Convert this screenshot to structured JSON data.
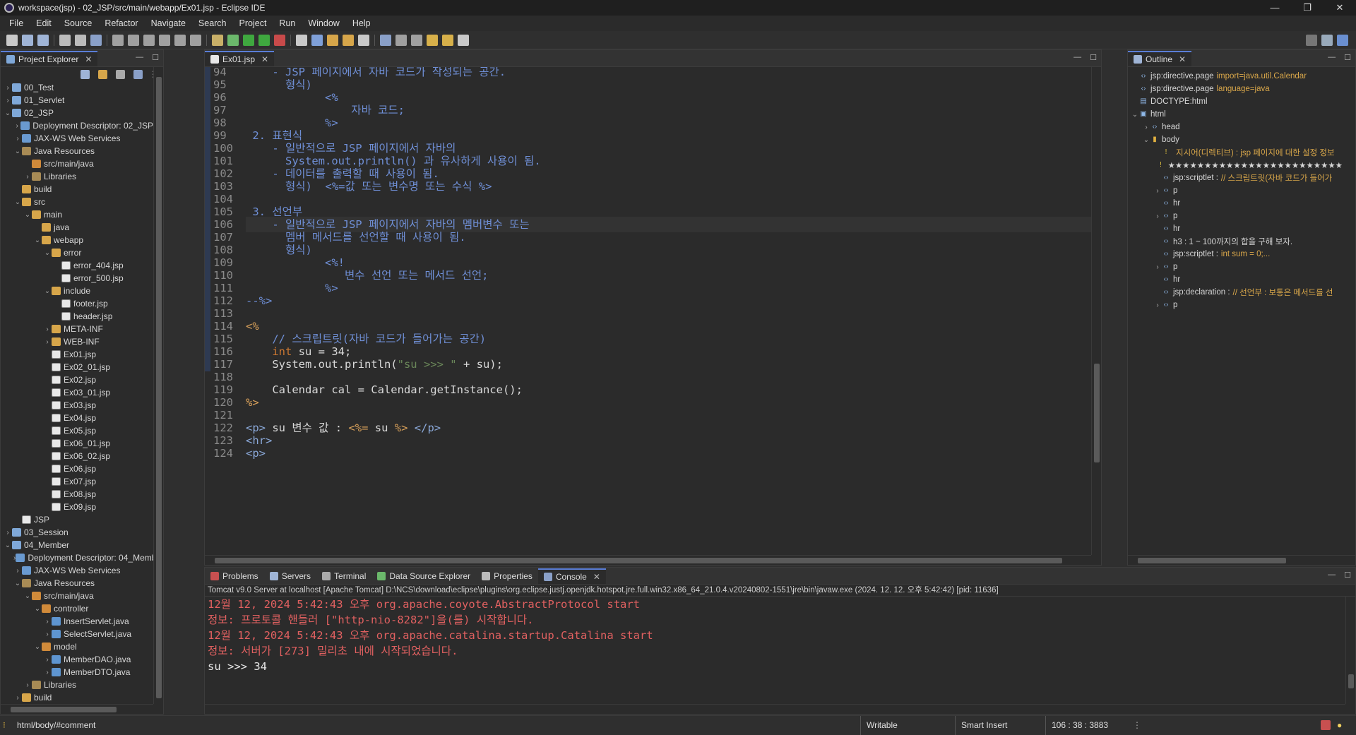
{
  "window": {
    "title": "workspace(jsp) - 02_JSP/src/main/webapp/Ex01.jsp - Eclipse IDE",
    "minimize": "—",
    "restore": "❐",
    "close": "✕"
  },
  "menu": [
    "File",
    "Edit",
    "Source",
    "Refactor",
    "Navigate",
    "Search",
    "Project",
    "Run",
    "Window",
    "Help"
  ],
  "explorer": {
    "tab": "Project Explorer",
    "items": [
      {
        "d": 0,
        "a": "›",
        "i": "proj",
        "t": "00_Test"
      },
      {
        "d": 0,
        "a": "›",
        "i": "proj",
        "t": "01_Servlet"
      },
      {
        "d": 0,
        "a": "⌄",
        "i": "proj",
        "t": "02_JSP"
      },
      {
        "d": 1,
        "a": "›",
        "i": "web",
        "t": "Deployment Descriptor: 02_JSP"
      },
      {
        "d": 1,
        "a": "›",
        "i": "web",
        "t": "JAX-WS Web Services"
      },
      {
        "d": 1,
        "a": "⌄",
        "i": "lib",
        "t": "Java Resources"
      },
      {
        "d": 2,
        "a": "",
        "i": "pkg",
        "t": "src/main/java"
      },
      {
        "d": 2,
        "a": "›",
        "i": "lib",
        "t": "Libraries"
      },
      {
        "d": 1,
        "a": "",
        "i": "folder",
        "t": "build"
      },
      {
        "d": 1,
        "a": "⌄",
        "i": "folder",
        "t": "src"
      },
      {
        "d": 2,
        "a": "⌄",
        "i": "folder",
        "t": "main"
      },
      {
        "d": 3,
        "a": "",
        "i": "folder",
        "t": "java"
      },
      {
        "d": 3,
        "a": "⌄",
        "i": "folder",
        "t": "webapp"
      },
      {
        "d": 4,
        "a": "⌄",
        "i": "folder",
        "t": "error"
      },
      {
        "d": 5,
        "a": "",
        "i": "file",
        "t": "error_404.jsp"
      },
      {
        "d": 5,
        "a": "",
        "i": "file",
        "t": "error_500.jsp"
      },
      {
        "d": 4,
        "a": "⌄",
        "i": "folder",
        "t": "include"
      },
      {
        "d": 5,
        "a": "",
        "i": "file",
        "t": "footer.jsp"
      },
      {
        "d": 5,
        "a": "",
        "i": "file",
        "t": "header.jsp"
      },
      {
        "d": 4,
        "a": "›",
        "i": "folder",
        "t": "META-INF"
      },
      {
        "d": 4,
        "a": "›",
        "i": "folder",
        "t": "WEB-INF"
      },
      {
        "d": 4,
        "a": "",
        "i": "file",
        "t": "Ex01.jsp"
      },
      {
        "d": 4,
        "a": "",
        "i": "file",
        "t": "Ex02_01.jsp"
      },
      {
        "d": 4,
        "a": "",
        "i": "file",
        "t": "Ex02.jsp"
      },
      {
        "d": 4,
        "a": "",
        "i": "file",
        "t": "Ex03_01.jsp"
      },
      {
        "d": 4,
        "a": "",
        "i": "file",
        "t": "Ex03.jsp"
      },
      {
        "d": 4,
        "a": "",
        "i": "file",
        "t": "Ex04.jsp"
      },
      {
        "d": 4,
        "a": "",
        "i": "file",
        "t": "Ex05.jsp"
      },
      {
        "d": 4,
        "a": "",
        "i": "file",
        "t": "Ex06_01.jsp"
      },
      {
        "d": 4,
        "a": "",
        "i": "file",
        "t": "Ex06_02.jsp"
      },
      {
        "d": 4,
        "a": "",
        "i": "file",
        "t": "Ex06.jsp"
      },
      {
        "d": 4,
        "a": "",
        "i": "file",
        "t": "Ex07.jsp"
      },
      {
        "d": 4,
        "a": "",
        "i": "file",
        "t": "Ex08.jsp"
      },
      {
        "d": 4,
        "a": "",
        "i": "file",
        "t": "Ex09.jsp"
      },
      {
        "d": 1,
        "a": "",
        "i": "file",
        "t": "JSP"
      },
      {
        "d": 0,
        "a": "›",
        "i": "proj",
        "t": "03_Session"
      },
      {
        "d": 0,
        "a": "⌄",
        "i": "proj",
        "t": "04_Member"
      },
      {
        "d": 1,
        "a": "›",
        "i": "web",
        "t": "Deployment Descriptor: 04_Member"
      },
      {
        "d": 1,
        "a": "›",
        "i": "web",
        "t": "JAX-WS Web Services"
      },
      {
        "d": 1,
        "a": "⌄",
        "i": "lib",
        "t": "Java Resources"
      },
      {
        "d": 2,
        "a": "⌄",
        "i": "pkg",
        "t": "src/main/java"
      },
      {
        "d": 3,
        "a": "⌄",
        "i": "pkg",
        "t": "controller"
      },
      {
        "d": 4,
        "a": "›",
        "i": "java",
        "t": "InsertServlet.java"
      },
      {
        "d": 4,
        "a": "›",
        "i": "java",
        "t": "SelectServlet.java"
      },
      {
        "d": 3,
        "a": "⌄",
        "i": "pkg",
        "t": "model"
      },
      {
        "d": 4,
        "a": "›",
        "i": "java",
        "t": "MemberDAO.java"
      },
      {
        "d": 4,
        "a": "›",
        "i": "java",
        "t": "MemberDTO.java"
      },
      {
        "d": 2,
        "a": "›",
        "i": "lib",
        "t": "Libraries"
      },
      {
        "d": 1,
        "a": "›",
        "i": "folder",
        "t": "build"
      }
    ]
  },
  "editor": {
    "tab": "Ex01.jsp",
    "lines": [
      {
        "n": "94",
        "h": "<span class='cm'>    - JSP 페이지에서 자바 코드가 작성되는 공간.</span>"
      },
      {
        "n": "95",
        "h": "<span class='cm'>      형식)</span>"
      },
      {
        "n": "96",
        "h": "<span class='cm'>            &lt;%</span>"
      },
      {
        "n": "97",
        "h": "<span class='cm'>                자바 코드;</span>"
      },
      {
        "n": "98",
        "h": "<span class='cm'>            %&gt;</span>"
      },
      {
        "n": "99",
        "h": "<span class='cm'> 2. 표현식</span>"
      },
      {
        "n": "100",
        "h": "<span class='cm'>    - 일반적으로 JSP 페이지에서 자바의</span>"
      },
      {
        "n": "101",
        "h": "<span class='cm'>      System.out.println() 과 유사하게 사용이 됨.</span>"
      },
      {
        "n": "102",
        "h": "<span class='cm'>    - 데이터를 출력할 때 사용이 됨.</span>"
      },
      {
        "n": "103",
        "h": "<span class='cm'>      형식)  &lt;%=값 또는 변수명 또는 수식 %&gt;</span>"
      },
      {
        "n": "104",
        "h": ""
      },
      {
        "n": "105",
        "h": "<span class='cm'> 3. 선언부</span>"
      },
      {
        "n": "106",
        "h": "<span class='cm'>    - 일반적으로 JSP 페이지에서 자바의 멤버변수 또는</span>",
        "cur": true
      },
      {
        "n": "107",
        "h": "<span class='cm'>      멤버 메서드를 선언할 때 사용이 됨.</span>"
      },
      {
        "n": "108",
        "h": "<span class='cm'>      형식)</span>"
      },
      {
        "n": "109",
        "h": "<span class='cm'>            &lt;%!</span>"
      },
      {
        "n": "110",
        "h": "<span class='cm'>               변수 선언 또는 메서드 선언;</span>"
      },
      {
        "n": "111",
        "h": "<span class='cm'>            %&gt;</span>"
      },
      {
        "n": "112",
        "h": "<span class='cm'>--%&gt;</span>"
      },
      {
        "n": "113",
        "h": ""
      },
      {
        "n": "114",
        "h": "<span class='jsp'>&lt;%</span>"
      },
      {
        "n": "115",
        "h": "<span class='cm'>    // 스크립트릿(자바 코드가 들어가는 공간)</span>"
      },
      {
        "n": "116",
        "h": "    <span class='kw'>int</span> su = 34;"
      },
      {
        "n": "117",
        "h": "    System.out.println(<span class='str'>\"su >>> \"</span> + su);"
      },
      {
        "n": "118",
        "h": ""
      },
      {
        "n": "119",
        "h": "    Calendar cal = Calendar.getInstance();"
      },
      {
        "n": "120",
        "h": "<span class='jsp'>%&gt;</span>"
      },
      {
        "n": "121",
        "h": ""
      },
      {
        "n": "122",
        "h": "<span class='tag'>&lt;p&gt;</span> su 변수 값 : <span class='jsp'>&lt;%=</span> su <span class='jsp'>%&gt;</span> <span class='tag'>&lt;/p&gt;</span>"
      },
      {
        "n": "123",
        "h": "<span class='tag'>&lt;hr&gt;</span>"
      },
      {
        "n": "124",
        "h": "<span class='tag'>&lt;p&gt;</span>"
      }
    ]
  },
  "outline": {
    "tab": "Outline",
    "items": [
      {
        "d": 0,
        "a": "",
        "ic": "‹›",
        "t": "jsp:directive.page",
        "x": "import=java.util.Calendar"
      },
      {
        "d": 0,
        "a": "",
        "ic": "‹›",
        "t": "jsp:directive.page",
        "x": "language=java"
      },
      {
        "d": 0,
        "a": "",
        "ic": "▤",
        "t": "DOCTYPE:html",
        "x": ""
      },
      {
        "d": 0,
        "a": "⌄",
        "ic": "▣",
        "t": "html",
        "x": ""
      },
      {
        "d": 1,
        "a": "›",
        "ic": "‹›",
        "t": "head",
        "x": ""
      },
      {
        "d": 1,
        "a": "⌄",
        "ic": "▮",
        "t": "body",
        "x": ""
      },
      {
        "d": 2,
        "a": "",
        "ic": "!",
        "t": "",
        "x": "지시어(디렉티브) : jsp 페이지에 대한 설정 정보"
      },
      {
        "d": 2,
        "a": "",
        "ic": "!",
        "t": "★★★★★★★★★★★★★★★★★★★★★★★★",
        "x": ""
      },
      {
        "d": 2,
        "a": "",
        "ic": "‹›",
        "t": "jsp:scriptlet :",
        "x": "// 스크립트릿(자바 코드가 들어가"
      },
      {
        "d": 2,
        "a": "›",
        "ic": "‹›",
        "t": "p",
        "x": ""
      },
      {
        "d": 2,
        "a": "",
        "ic": "‹›",
        "t": "hr",
        "x": ""
      },
      {
        "d": 2,
        "a": "›",
        "ic": "‹›",
        "t": "p",
        "x": ""
      },
      {
        "d": 2,
        "a": "",
        "ic": "‹›",
        "t": "hr",
        "x": ""
      },
      {
        "d": 2,
        "a": "",
        "ic": "‹›",
        "t": "h3 : 1 ~ 100까지의 합을 구해 보자.",
        "x": ""
      },
      {
        "d": 2,
        "a": "",
        "ic": "‹›",
        "t": "jsp:scriptlet :",
        "x": "int sum = 0;..."
      },
      {
        "d": 2,
        "a": "›",
        "ic": "‹›",
        "t": "p",
        "x": ""
      },
      {
        "d": 2,
        "a": "",
        "ic": "‹›",
        "t": "hr",
        "x": ""
      },
      {
        "d": 2,
        "a": "",
        "ic": "‹›",
        "t": "jsp:declaration :",
        "x": "// 선언부 : 보통은 메서드를 선"
      },
      {
        "d": 2,
        "a": "›",
        "ic": "‹›",
        "t": "p",
        "x": ""
      }
    ]
  },
  "bottom": {
    "tabs": [
      "Problems",
      "Servers",
      "Terminal",
      "Data Source Explorer",
      "Properties",
      "Console"
    ],
    "info": "Tomcat v9.0 Server at localhost [Apache Tomcat] D:\\NCS\\download\\eclipse\\plugins\\org.eclipse.justj.openjdk.hotspot.jre.full.win32.x86_64_21.0.4.v20240802-1551\\jre\\bin\\javaw.exe  (2024. 12. 12. 오후 5:42:42) [pid: 11636]",
    "lines": [
      {
        "c": "err",
        "t": "12월 12, 2024 5:42:43 오후 org.apache.coyote.AbstractProtocol start"
      },
      {
        "c": "err",
        "t": "정보: 프로토콜 핸들러 [\"http-nio-8282\"]을(를) 시작합니다."
      },
      {
        "c": "err",
        "t": "12월 12, 2024 5:42:43 오후 org.apache.catalina.startup.Catalina start"
      },
      {
        "c": "err",
        "t": "정보: 서버가 [273] 밀리초 내에 시작되었습니다."
      },
      {
        "c": "out",
        "t": "su >>> 34"
      }
    ]
  },
  "status": {
    "path": "html/body/#comment",
    "writable": "Writable",
    "insert": "Smart Insert",
    "pos": "106 : 38 : 3883"
  }
}
